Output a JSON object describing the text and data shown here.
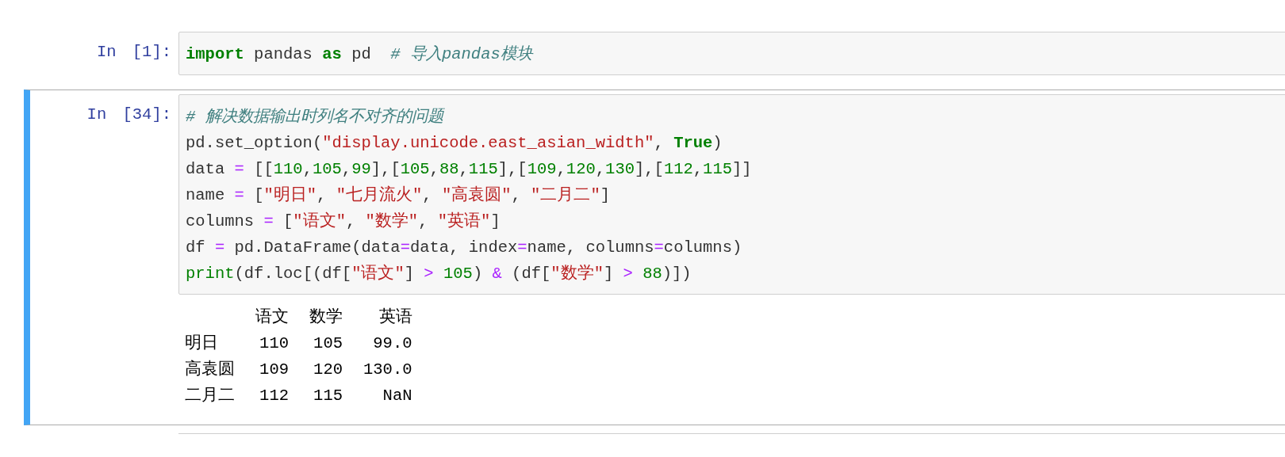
{
  "cells": [
    {
      "prompt": "In [1]:",
      "selected": false,
      "code": [
        [
          {
            "kind": "keyword",
            "text": "import"
          },
          {
            "kind": "plain",
            "text": " pandas "
          },
          {
            "kind": "keyword",
            "text": "as"
          },
          {
            "kind": "plain",
            "text": " pd  "
          },
          {
            "kind": "comment",
            "text": "# 导入pandas模块"
          }
        ]
      ]
    },
    {
      "prompt": "In [34]:",
      "selected": true,
      "code": [
        [
          {
            "kind": "comment",
            "text": "# 解决数据输出时列名不对齐的问题"
          }
        ],
        [
          {
            "kind": "plain",
            "text": "pd.set_option("
          },
          {
            "kind": "string",
            "text": "\"display.unicode.east_asian_width\""
          },
          {
            "kind": "plain",
            "text": ", "
          },
          {
            "kind": "keyword",
            "text": "True"
          },
          {
            "kind": "plain",
            "text": ")"
          }
        ],
        [
          {
            "kind": "plain",
            "text": "data "
          },
          {
            "kind": "operator",
            "text": "="
          },
          {
            "kind": "plain",
            "text": " [["
          },
          {
            "kind": "number",
            "text": "110"
          },
          {
            "kind": "plain",
            "text": ","
          },
          {
            "kind": "number",
            "text": "105"
          },
          {
            "kind": "plain",
            "text": ","
          },
          {
            "kind": "number",
            "text": "99"
          },
          {
            "kind": "plain",
            "text": "],["
          },
          {
            "kind": "number",
            "text": "105"
          },
          {
            "kind": "plain",
            "text": ","
          },
          {
            "kind": "number",
            "text": "88"
          },
          {
            "kind": "plain",
            "text": ","
          },
          {
            "kind": "number",
            "text": "115"
          },
          {
            "kind": "plain",
            "text": "],["
          },
          {
            "kind": "number",
            "text": "109"
          },
          {
            "kind": "plain",
            "text": ","
          },
          {
            "kind": "number",
            "text": "120"
          },
          {
            "kind": "plain",
            "text": ","
          },
          {
            "kind": "number",
            "text": "130"
          },
          {
            "kind": "plain",
            "text": "],["
          },
          {
            "kind": "number",
            "text": "112"
          },
          {
            "kind": "plain",
            "text": ","
          },
          {
            "kind": "number",
            "text": "115"
          },
          {
            "kind": "plain",
            "text": "]]"
          }
        ],
        [
          {
            "kind": "plain",
            "text": "name "
          },
          {
            "kind": "operator",
            "text": "="
          },
          {
            "kind": "plain",
            "text": " ["
          },
          {
            "kind": "string",
            "text": "\"明日\""
          },
          {
            "kind": "plain",
            "text": ", "
          },
          {
            "kind": "string",
            "text": "\"七月流火\""
          },
          {
            "kind": "plain",
            "text": ", "
          },
          {
            "kind": "string",
            "text": "\"高袁圆\""
          },
          {
            "kind": "plain",
            "text": ", "
          },
          {
            "kind": "string",
            "text": "\"二月二\""
          },
          {
            "kind": "plain",
            "text": "]"
          }
        ],
        [
          {
            "kind": "plain",
            "text": "columns "
          },
          {
            "kind": "operator",
            "text": "="
          },
          {
            "kind": "plain",
            "text": " ["
          },
          {
            "kind": "string",
            "text": "\"语文\""
          },
          {
            "kind": "plain",
            "text": ", "
          },
          {
            "kind": "string",
            "text": "\"数学\""
          },
          {
            "kind": "plain",
            "text": ", "
          },
          {
            "kind": "string",
            "text": "\"英语\""
          },
          {
            "kind": "plain",
            "text": "]"
          }
        ],
        [
          {
            "kind": "plain",
            "text": "df "
          },
          {
            "kind": "operator",
            "text": "="
          },
          {
            "kind": "plain",
            "text": " pd.DataFrame(data"
          },
          {
            "kind": "operator",
            "text": "="
          },
          {
            "kind": "plain",
            "text": "data, index"
          },
          {
            "kind": "operator",
            "text": "="
          },
          {
            "kind": "plain",
            "text": "name, columns"
          },
          {
            "kind": "operator",
            "text": "="
          },
          {
            "kind": "plain",
            "text": "columns)"
          }
        ],
        [
          {
            "kind": "builtin",
            "text": "print"
          },
          {
            "kind": "plain",
            "text": "(df.loc[(df["
          },
          {
            "kind": "string",
            "text": "\"语文\""
          },
          {
            "kind": "plain",
            "text": "] "
          },
          {
            "kind": "operator",
            "text": ">"
          },
          {
            "kind": "number",
            "text": " 105"
          },
          {
            "kind": "plain",
            "text": ") "
          },
          {
            "kind": "operator",
            "text": "&"
          },
          {
            "kind": "plain",
            "text": " (df["
          },
          {
            "kind": "string",
            "text": "\"数学\""
          },
          {
            "kind": "plain",
            "text": "] "
          },
          {
            "kind": "operator",
            "text": ">"
          },
          {
            "kind": "number",
            "text": " 88"
          },
          {
            "kind": "plain",
            "text": ")])"
          }
        ]
      ],
      "output": {
        "columns": [
          "语文",
          "数学",
          "英语"
        ],
        "rows": [
          {
            "index": "明日",
            "values": [
              "110",
              "105",
              "99.0"
            ]
          },
          {
            "index": "高袁圆",
            "values": [
              "109",
              "120",
              "130.0"
            ]
          },
          {
            "index": "二月二",
            "values": [
              "112",
              "115",
              "NaN"
            ]
          }
        ]
      }
    }
  ]
}
